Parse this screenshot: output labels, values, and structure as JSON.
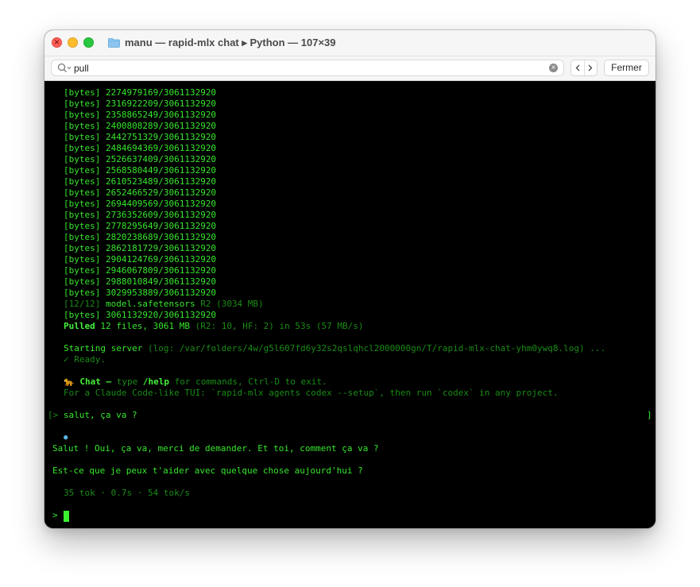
{
  "window": {
    "title": "manu — rapid-mlx chat ▸ Python — 107×39"
  },
  "find": {
    "query": "pull",
    "close_label": "Fermer"
  },
  "progress": [
    {
      "tag": "[bytes]",
      "value": "2274979169/3061132920"
    },
    {
      "tag": "[bytes]",
      "value": "2316922209/3061132920"
    },
    {
      "tag": "[bytes]",
      "value": "2358865249/3061132920"
    },
    {
      "tag": "[bytes]",
      "value": "2400808289/3061132920"
    },
    {
      "tag": "[bytes]",
      "value": "2442751329/3061132920"
    },
    {
      "tag": "[bytes]",
      "value": "2484694369/3061132920"
    },
    {
      "tag": "[bytes]",
      "value": "2526637409/3061132920"
    },
    {
      "tag": "[bytes]",
      "value": "2568580449/3061132920"
    },
    {
      "tag": "[bytes]",
      "value": "2610523489/3061132920"
    },
    {
      "tag": "[bytes]",
      "value": "2652466529/3061132920"
    },
    {
      "tag": "[bytes]",
      "value": "2694409569/3061132920"
    },
    {
      "tag": "[bytes]",
      "value": "2736352609/3061132920"
    },
    {
      "tag": "[bytes]",
      "value": "2778295649/3061132920"
    },
    {
      "tag": "[bytes]",
      "value": "2820238689/3061132920"
    },
    {
      "tag": "[bytes]",
      "value": "2862181729/3061132920"
    },
    {
      "tag": "[bytes]",
      "value": "2904124769/3061132920"
    },
    {
      "tag": "[bytes]",
      "value": "2946067809/3061132920"
    },
    {
      "tag": "[bytes]",
      "value": "2988010849/3061132920"
    },
    {
      "tag": "[bytes]",
      "value": "3029953889/3061132920"
    }
  ],
  "model_line": {
    "counter": "[12/12]",
    "file": "model.safetensors",
    "detail": "R2 (3034 MB)"
  },
  "final_progress": {
    "tag": "[bytes]",
    "value": "3061132920/3061132920"
  },
  "pulled": {
    "label": "Pulled",
    "summary": "12 files, 3061 MB",
    "detail": "(R2: 10, HF: 2) in 53s (57 MB/s)"
  },
  "server": {
    "label": "Starting server",
    "log": "(log: /var/folders/4w/g5l607fd6y32s2qslqhcl2000000gn/T/rapid-mlx-chat-yhm0ywq8.log) ...",
    "ready": "✓ Ready."
  },
  "chat_intro": {
    "emoji": "🐆",
    "title": "Chat —",
    "pre": "type",
    "cmd": "/help",
    "post": "for commands, Ctrl-D to exit.",
    "hint": "For a Claude Code-like TUI: `rapid-mlx agents codex --setup`, then run `codex` in any project."
  },
  "conversation": {
    "prompt_symbol": "[>",
    "user_message": "salut, ça va ?",
    "close_bracket": "]",
    "thinking_dot": "●",
    "reply_1": "Salut ! Oui, ça va, merci de demander. Et toi, comment ça va ?",
    "reply_2": "Est-ce que je peux t'aider avec quelque chose aujourd'hui ?",
    "stats": "35 tok · 0.7s · 54 tok/s",
    "input_prompt": ">"
  }
}
